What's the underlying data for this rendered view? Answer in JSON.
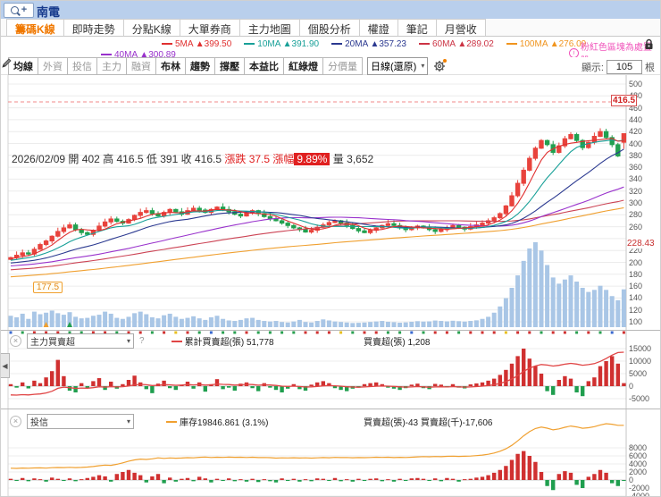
{
  "titlebar": {
    "title": "南電"
  },
  "icons": {
    "collapse": "◀",
    "dropdown": "▾",
    "close": "×",
    "help": "?",
    "info": "i",
    "plus": "+"
  },
  "tabs": {
    "items": [
      "籌碼K線",
      "即時走勢",
      "分點K線",
      "大單券商",
      "主力地圖",
      "個股分析",
      "權證",
      "筆記",
      "月營收"
    ],
    "active_index": 0
  },
  "ma_legend": {
    "row1": [
      {
        "label": "5MA",
        "value": "▲399.50",
        "color": "#e03030"
      },
      {
        "label": "10MA",
        "value": "▲391.90",
        "color": "#18a098"
      },
      {
        "label": "20MA",
        "value": "▲357.23",
        "color": "#2b3990"
      },
      {
        "label": "60MA",
        "value": "▲289.02",
        "color": "#cc3344"
      },
      {
        "label": "100MA",
        "value": "▲276.09",
        "color": "#f0941e"
      }
    ],
    "row2": [
      {
        "label": "40MA",
        "value": "▲300.89",
        "color": "#9932cc"
      }
    ],
    "note": "粉紅色區塊為處置股"
  },
  "toolbar": {
    "buttons": [
      {
        "label": "均線",
        "active": true
      },
      {
        "label": "外資",
        "active": false
      },
      {
        "label": "投信",
        "active": false
      },
      {
        "label": "主力",
        "active": false
      },
      {
        "label": "融資",
        "active": false
      },
      {
        "label": "布林",
        "active": true
      },
      {
        "label": "趨勢",
        "active": true
      },
      {
        "label": "撐壓",
        "active": true
      },
      {
        "label": "本益比",
        "active": true
      },
      {
        "label": "紅綠燈",
        "active": true
      },
      {
        "label": "分價量",
        "active": false
      }
    ],
    "period_select": "日線(還原)",
    "display_label": "顯示:",
    "display_value": "105",
    "display_unit": "根"
  },
  "quote": {
    "date": "2026/02/09",
    "open_label": "開",
    "open": "402",
    "high_label": "高",
    "high": "416.5",
    "low_label": "低",
    "low": "391",
    "close_label": "收",
    "close": "416.5",
    "change_label": "漲跌",
    "change": "37.5",
    "change_pct_label": "漲幅",
    "change_pct": "9.89%",
    "volume_label": "量",
    "volume": "3,652"
  },
  "main_chart": {
    "y_ticks": [
      500,
      480,
      460,
      440,
      420,
      400,
      380,
      360,
      340,
      320,
      300,
      280,
      260,
      220,
      200,
      180,
      160,
      140,
      120,
      100
    ],
    "close_marker": "416.5",
    "ma_marker": "228.43",
    "low_marker": "177.5"
  },
  "panel2": {
    "select": "主力買賣超",
    "line_legend": "累計買賣超(張) 51,778",
    "bar_legend": "買賣超(張) 1,208",
    "y_ticks": [
      15000,
      10000,
      5000,
      0,
      -5000
    ]
  },
  "panel3": {
    "select": "投信",
    "line_legend": "庫存19846.861 (3.1%)",
    "bar_legend": "買賣超(張)-43 買賣超(千)-17,606",
    "y_ticks": [
      8000,
      6000,
      4000,
      2000,
      0,
      -2000,
      -4000
    ]
  },
  "chart_data": {
    "type": "candlestick",
    "bars_shown": 105,
    "price_axis": {
      "min": 100,
      "max": 500,
      "step": 20
    },
    "closes": [
      208,
      212,
      216,
      214,
      222,
      230,
      236,
      244,
      252,
      258,
      263,
      255,
      250,
      247,
      254,
      261,
      268,
      273,
      269,
      266,
      272,
      279,
      284,
      287,
      282,
      278,
      284,
      289,
      285,
      281,
      287,
      291,
      288,
      284,
      289,
      293,
      289,
      285,
      281,
      278,
      283,
      287,
      282,
      277,
      273,
      270,
      266,
      262,
      258,
      255,
      251,
      254,
      259,
      263,
      267,
      270,
      266,
      262,
      257,
      253,
      250,
      254,
      258,
      262,
      265,
      262,
      258,
      255,
      258,
      261,
      258,
      255,
      252,
      255,
      258,
      262,
      259,
      256,
      260,
      263,
      266,
      270,
      275,
      282,
      295,
      312,
      333,
      355,
      375,
      392,
      405,
      398,
      385,
      396,
      408,
      415,
      405,
      393,
      402,
      412,
      420,
      410,
      398,
      379,
      416.5
    ],
    "last_candle": {
      "open": 402,
      "high": 416.5,
      "low": 391,
      "close": 416.5
    },
    "volumes": [
      1100,
      950,
      1300,
      800,
      1500,
      1250,
      1400,
      1600,
      1350,
      1200,
      1450,
      1000,
      850,
      900,
      1100,
      1200,
      1500,
      1300,
      900,
      800,
      1000,
      1350,
      1500,
      1250,
      950,
      850,
      1150,
      1300,
      1000,
      800,
      900,
      1050,
      850,
      700,
      950,
      1100,
      800,
      650,
      600,
      700,
      850,
      900,
      700,
      600,
      550,
      600,
      500,
      450,
      550,
      700,
      500,
      450,
      600,
      750,
      650,
      550,
      500,
      450,
      400,
      420,
      450,
      500,
      550,
      600,
      520,
      480,
      430,
      460,
      520,
      580,
      540,
      560,
      640,
      600,
      560,
      620,
      580,
      540,
      600,
      660,
      800,
      1000,
      1400,
      2000,
      2800,
      3800,
      5000,
      6400,
      7600,
      8200,
      7400,
      6000,
      4800,
      4200,
      4600,
      5000,
      4400,
      3800,
      3400,
      3600,
      4000,
      3600,
      3000,
      2600,
      3652
    ],
    "ma": [
      {
        "period": 100,
        "color": "#f0a030"
      },
      {
        "period": 60,
        "color": "#cc4455"
      },
      {
        "period": 40,
        "color": "#9932cc"
      },
      {
        "period": 20,
        "color": "#2b3990"
      },
      {
        "period": 10,
        "color": "#18a098"
      },
      {
        "period": 5,
        "color": "#e03030"
      }
    ],
    "pre_history": {
      "start": 145,
      "end": 205,
      "count": 100
    },
    "panel2_axis": {
      "min": -5000,
      "max": 15000,
      "step": 5000
    },
    "panel2_bars": [
      800,
      -600,
      1500,
      -900,
      2200,
      1200,
      3500,
      6000,
      10500,
      4000,
      -1800,
      -2500,
      1200,
      -800,
      2000,
      3200,
      -1500,
      1800,
      -1000,
      800,
      2500,
      4200,
      1500,
      -1200,
      -2800,
      1000,
      2200,
      -800,
      -1500,
      600,
      1800,
      -1000,
      1500,
      -2200,
      800,
      2800,
      -1200,
      -600,
      -1800,
      1000,
      1500,
      -800,
      -2000,
      1200,
      -600,
      -1500,
      -2500,
      -1000,
      800,
      -1200,
      -1800,
      600,
      1500,
      2000,
      1200,
      -800,
      -1500,
      -2000,
      -1000,
      -600,
      800,
      1200,
      1500,
      800,
      -600,
      -1000,
      -1500,
      -800,
      600,
      1000,
      -800,
      -1200,
      900,
      600,
      -500,
      800,
      -600,
      -900,
      700,
      1100,
      1500,
      2200,
      3000,
      4500,
      6500,
      9000,
      12000,
      15000,
      11000,
      8000,
      5000,
      -2000,
      -3500,
      2500,
      4000,
      3000,
      -2500,
      -4000,
      2000,
      3500,
      8000,
      10000,
      12000,
      9000,
      1208
    ],
    "panel3_axis": {
      "min": -4000,
      "max": 8000,
      "step": 2000
    },
    "panel3_bars": [
      300,
      -200,
      500,
      -300,
      400,
      200,
      -400,
      600,
      300,
      -200,
      400,
      -300,
      200,
      500,
      800,
      1200,
      900,
      -400,
      1500,
      2000,
      2500,
      1800,
      1200,
      -600,
      900,
      1500,
      -800,
      600,
      -400,
      300,
      500,
      -300,
      800,
      400,
      -600,
      300,
      -200,
      400,
      -300,
      200,
      -400,
      300,
      -500,
      200,
      -300,
      -600,
      400,
      -200,
      300,
      -400,
      200,
      -300,
      400,
      300,
      -200,
      500,
      -300,
      200,
      -400,
      300,
      -200,
      300,
      400,
      -300,
      200,
      -400,
      300,
      -200,
      400,
      500,
      300,
      -200,
      400,
      -300,
      500,
      300,
      -400,
      200,
      300,
      600,
      800,
      1200,
      1800,
      2500,
      3500,
      5000,
      6500,
      7200,
      6000,
      4500,
      2000,
      -1500,
      -2500,
      1500,
      2200,
      1800,
      -1200,
      -2000,
      800,
      1500,
      2500,
      1800,
      -800,
      -1500,
      -43
    ],
    "colors": {
      "up": "#e8433c",
      "down": "#22a04f",
      "volume": "#a9c6e6",
      "panel2_line": "#e04545",
      "panel3_line": "#f0a030"
    }
  }
}
